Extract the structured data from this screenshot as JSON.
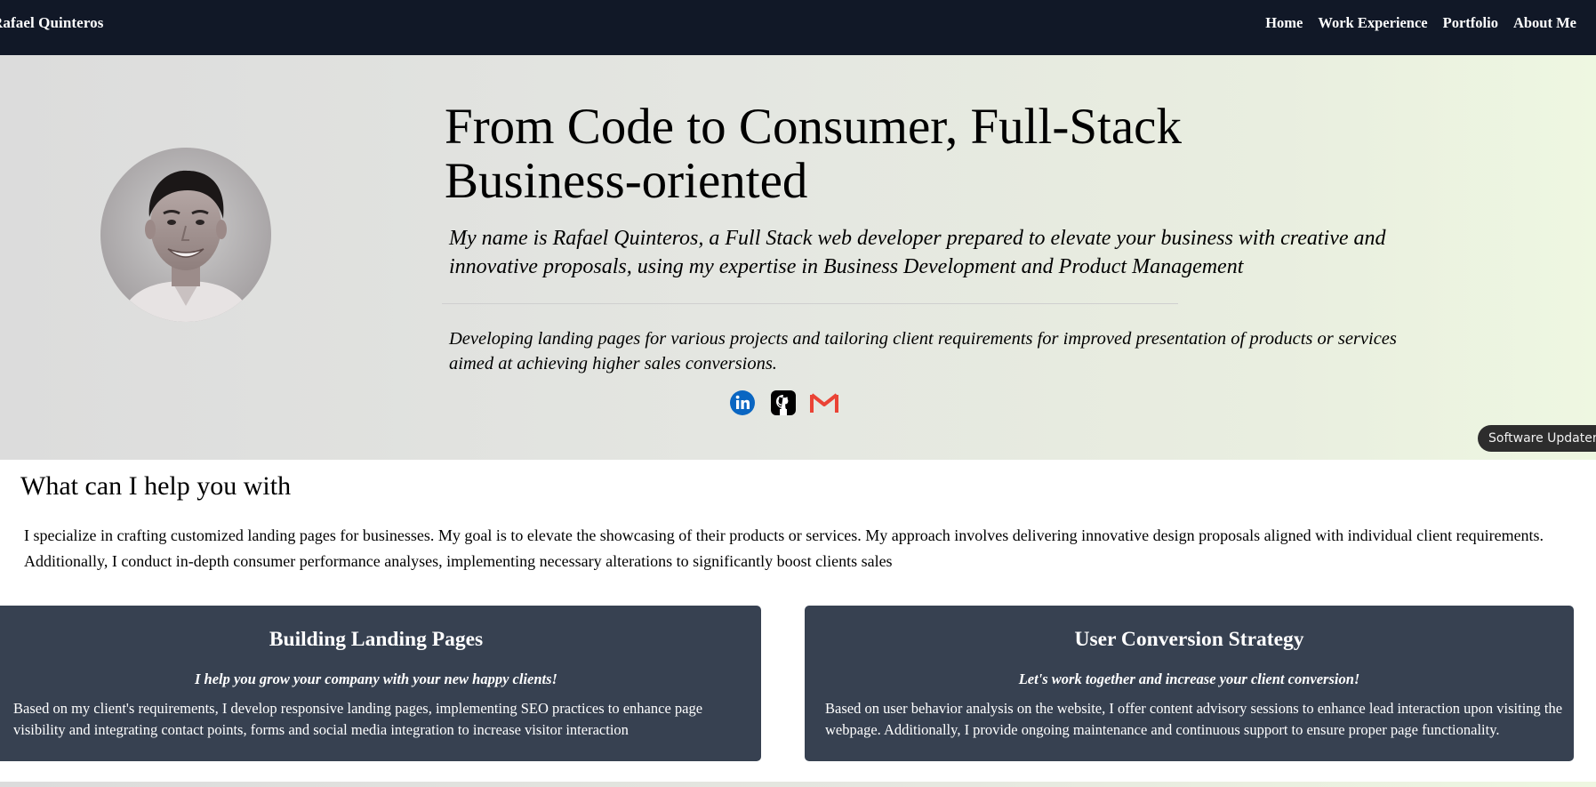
{
  "nav": {
    "brand": "Rafael Quinteros",
    "links": [
      "Home",
      "Work Experience",
      "Portfolio",
      "About Me"
    ]
  },
  "hero": {
    "title": "From Code to Consumer, Full-Stack Business-oriented",
    "intro": "My name is Rafael Quinteros, a Full Stack web developer prepared to elevate your business with creative and innovative proposals, using my expertise in Business Development and Product Management",
    "description": "Developing landing pages for various projects and tailoring client requirements for improved presentation of products or services aimed at achieving higher sales conversions.",
    "socials": [
      {
        "icon": "linkedin-icon",
        "color": "#0a66c2"
      },
      {
        "icon": "github-icon",
        "color": "#000000"
      },
      {
        "icon": "gmail-icon",
        "color": "#ea4335"
      }
    ]
  },
  "notification": {
    "label": "Software Updater"
  },
  "help": {
    "title": "What can I help you with",
    "text": "I specialize in crafting customized landing pages for businesses. My goal is to elevate the showcasing of their products or services. My approach involves delivering innovative design proposals aligned with individual client requirements. Additionally, I conduct in-depth consumer performance analyses, implementing necessary alterations to significantly boost clients sales"
  },
  "cards": [
    {
      "title": "Building Landing Pages",
      "subtitle": "I help you grow your company with your new happy clients!",
      "body": "Based on my client's requirements, I develop responsive landing pages, implementing SEO practices to enhance page visibility and integrating contact points, forms and social media integration to increase visitor interaction"
    },
    {
      "title": "User Conversion Strategy",
      "subtitle": "Let's work together and increase your client conversion!",
      "body": "Based on user behavior analysis on the website, I offer content advisory sessions to enhance lead interaction upon visiting the webpage. Additionally, I provide ongoing maintenance and continuous support to ensure proper page functionality."
    }
  ],
  "colors": {
    "nav_bg": "#111827",
    "card_bg": "#374151",
    "linkedin": "#0a66c2",
    "gmail_red": "#ea4335"
  }
}
